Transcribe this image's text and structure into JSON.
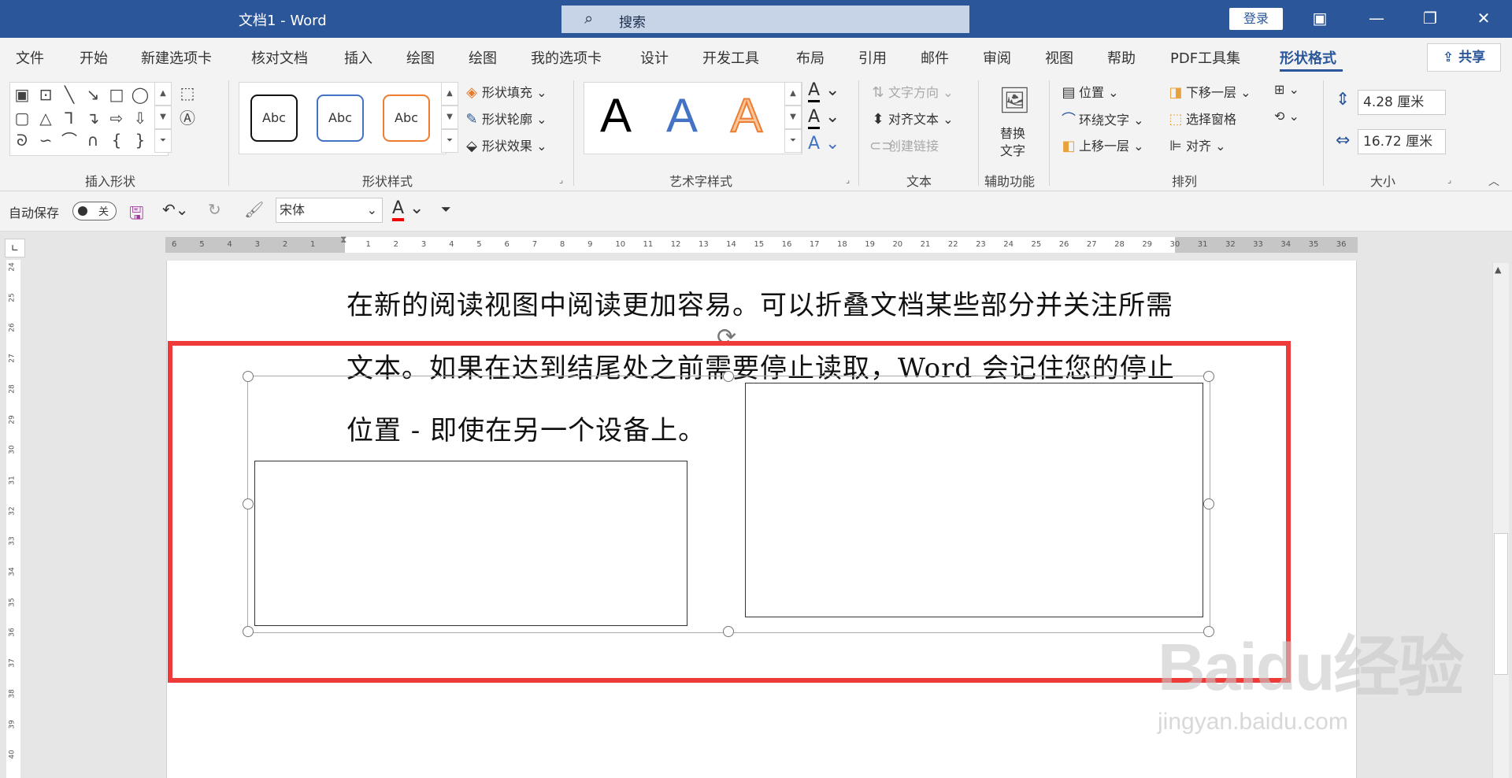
{
  "title": "文档1  -  Word",
  "search": {
    "placeholder": "搜索"
  },
  "login_label": "登录",
  "window": {
    "minimize": "—",
    "restore": "❐",
    "close": "✕",
    "ribbon_display": "▣"
  },
  "tabs": [
    "文件",
    "开始",
    "新建选项卡",
    "核对文档",
    "插入",
    "绘图",
    "绘图",
    "我的选项卡",
    "设计",
    "开发工具",
    "布局",
    "引用",
    "邮件",
    "审阅",
    "视图",
    "帮助",
    "PDF工具集",
    "形状格式"
  ],
  "share_label": "共享",
  "ribbon": {
    "insert_shapes": {
      "label": "插入形状"
    },
    "shape_styles": {
      "label": "形状样式",
      "presets": [
        "Abc",
        "Abc",
        "Abc"
      ],
      "fill": "形状填充",
      "outline": "形状轮廓",
      "effects": "形状效果"
    },
    "wordart_styles": {
      "label": "艺术字样式",
      "letters": [
        "A",
        "A",
        "A"
      ]
    },
    "text": {
      "label": "文本",
      "direction": "文字方向",
      "align": "对齐文本",
      "link": "创建链接"
    },
    "accessibility": {
      "label": "辅助功能",
      "alt_text_line1": "替换",
      "alt_text_line2": "文字"
    },
    "arrange": {
      "label": "排列",
      "position": "位置",
      "wrap": "环绕文字",
      "forward": "上移一层",
      "backward": "下移一层",
      "selection_pane": "选择窗格",
      "align": "对齐"
    },
    "size": {
      "label": "大小",
      "height": "4.28 厘米",
      "width": "16.72 厘米"
    }
  },
  "qat": {
    "autosave": "自动保存",
    "toggle_state": "关",
    "font": "宋体"
  },
  "ruler_h_labels": [
    "6",
    "5",
    "4",
    "3",
    "2",
    "1",
    "",
    "1",
    "2",
    "3",
    "4",
    "5",
    "6",
    "7",
    "8",
    "9",
    "10",
    "11",
    "12",
    "13",
    "14",
    "15",
    "16",
    "17",
    "18",
    "19",
    "20",
    "21",
    "22",
    "23",
    "24",
    "25",
    "26",
    "27",
    "28",
    "29",
    "30",
    "31",
    "32",
    "33",
    "34",
    "35",
    "36"
  ],
  "ruler_v_labels": [
    "24",
    "25",
    "26",
    "27",
    "28",
    "29",
    "30",
    "31",
    "32",
    "33",
    "34",
    "35",
    "36",
    "37",
    "38",
    "39",
    "40"
  ],
  "document": {
    "lines": [
      "在新的阅读视图中阅读更加容易。可以折叠文档某些部分并关注所需",
      "文本。如果在达到结尾处之前需要停止读取，Word  会记住您的停止",
      "位置 - 即使在另一个设备上。"
    ]
  },
  "watermark": {
    "brand": "Baidu经验",
    "url": "jingyan.baidu.com"
  },
  "colors": {
    "title_bar": "#2b579a",
    "highlight_frame": "#ef3a3a",
    "accent": "#2b579a"
  }
}
